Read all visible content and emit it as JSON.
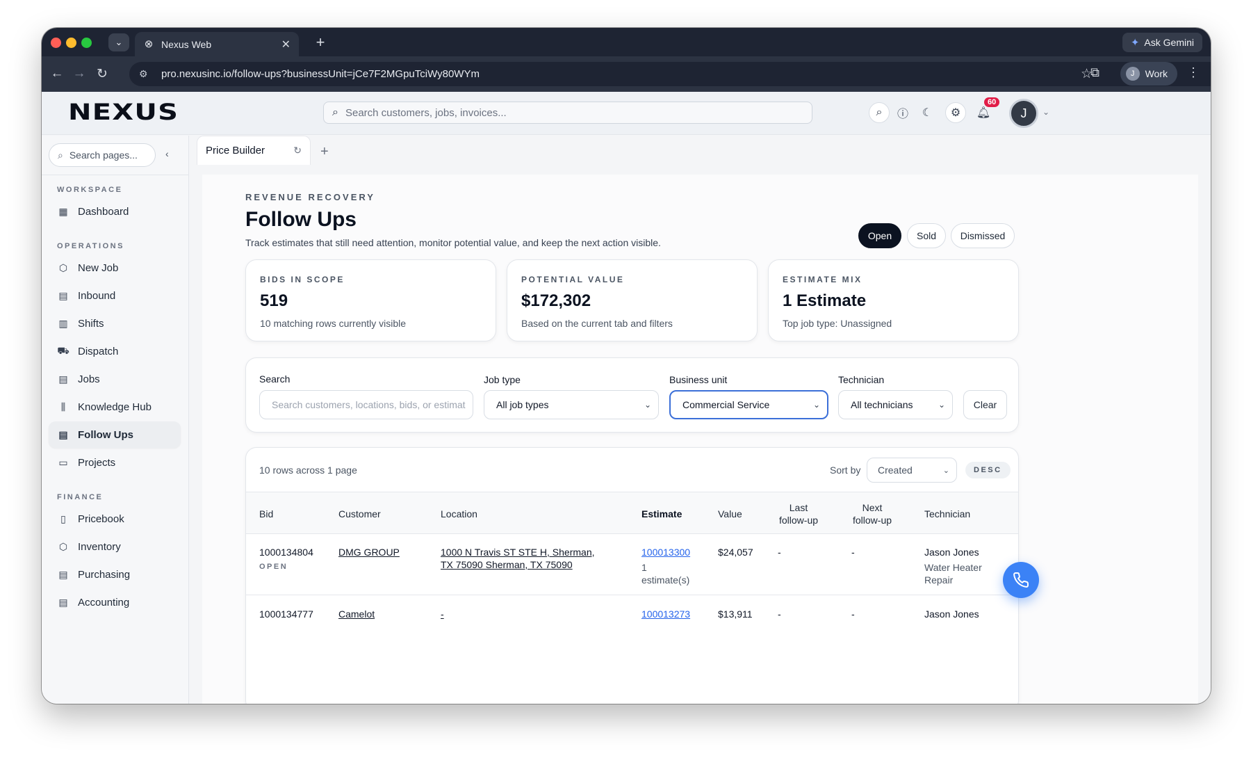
{
  "browser": {
    "tab_title": "Nexus Web",
    "url": "pro.nexusinc.io/follow-ups?businessUnit=jCe7F2MGpuTciWy80WYm",
    "gemini_label": "Ask Gemini",
    "profile_initial": "J",
    "profile_label": "Work"
  },
  "header": {
    "logo": "NEXUS",
    "search_placeholder": "Search customers, jobs, invoices...",
    "notification_count": "60",
    "avatar_initial": "J"
  },
  "sidebar": {
    "search_placeholder": "Search pages...",
    "sections": [
      {
        "title": "WORKSPACE",
        "items": [
          {
            "label": "Dashboard",
            "icon": "dashboard-icon"
          }
        ]
      },
      {
        "title": "OPERATIONS",
        "items": [
          {
            "label": "New Job",
            "icon": "cube-icon"
          },
          {
            "label": "Inbound",
            "icon": "clipboard-icon"
          },
          {
            "label": "Shifts",
            "icon": "calendar-icon"
          },
          {
            "label": "Dispatch",
            "icon": "truck-icon"
          },
          {
            "label": "Jobs",
            "icon": "clipboard-icon"
          },
          {
            "label": "Knowledge Hub",
            "icon": "library-icon"
          },
          {
            "label": "Follow Ups",
            "icon": "document-icon",
            "active": true
          },
          {
            "label": "Projects",
            "icon": "folder-icon"
          }
        ]
      },
      {
        "title": "FINANCE",
        "items": [
          {
            "label": "Pricebook",
            "icon": "book-icon"
          },
          {
            "label": "Inventory",
            "icon": "box-icon"
          },
          {
            "label": "Purchasing",
            "icon": "receipt-icon"
          },
          {
            "label": "Accounting",
            "icon": "document-icon"
          }
        ]
      }
    ]
  },
  "page_tabs": [
    {
      "label": "Price Builder"
    }
  ],
  "page": {
    "eyebrow": "REVENUE RECOVERY",
    "title": "Follow Ups",
    "description": "Track estimates that still need attention, monitor potential value, and keep the next action visible.",
    "status_tabs": [
      "Open",
      "Sold",
      "Dismissed"
    ],
    "active_status": "Open"
  },
  "stats": [
    {
      "label": "BIDS IN SCOPE",
      "value": "519",
      "sub": "10 matching rows currently visible"
    },
    {
      "label": "POTENTIAL VALUE",
      "value": "$172,302",
      "sub": "Based on the current tab and filters"
    },
    {
      "label": "ESTIMATE MIX",
      "value": "1 Estimate",
      "sub": "Top job type: Unassigned"
    }
  ],
  "filters": {
    "search_label": "Search",
    "search_placeholder": "Search customers, locations, bids, or estimat",
    "job_type_label": "Job type",
    "job_type_value": "All job types",
    "business_unit_label": "Business unit",
    "business_unit_value": "Commercial Service",
    "technician_label": "Technician",
    "technician_value": "All technicians",
    "clear_label": "Clear"
  },
  "table": {
    "summary": "10 rows across 1 page",
    "sort_label": "Sort by",
    "sort_value": "Created",
    "sort_dir": "DESC",
    "columns": [
      "Bid",
      "Customer",
      "Location",
      "Estimate",
      "Value",
      "Last follow-up",
      "Next follow-up",
      "Technician"
    ],
    "rows": [
      {
        "bid": "1000134804",
        "status": "OPEN",
        "customer": "DMG GROUP",
        "location": "1000 N Travis ST STE H, Sherman, TX 75090 Sherman, TX 75090",
        "estimate": "100013300",
        "estimate_count": "1 estimate(s)",
        "value": "$24,057",
        "last": "-",
        "next": "-",
        "technician": "Jason Jones",
        "job_type": "Water Heater Repair"
      },
      {
        "bid": "1000134777",
        "status": "",
        "customer": "Camelot",
        "location": "-",
        "estimate": "100013273",
        "estimate_count": "",
        "value": "$13,911",
        "last": "-",
        "next": "-",
        "technician": "Jason Jones",
        "job_type": ""
      }
    ]
  }
}
